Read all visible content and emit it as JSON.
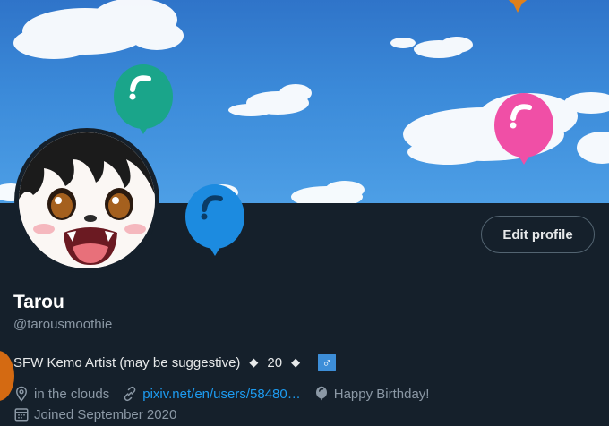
{
  "profile": {
    "display_name": "Tarou",
    "handle": "@tarousmoothie",
    "edit_button_label": "Edit profile",
    "bio": {
      "text": "SFW Kemo Artist (may be suggestive)",
      "sep1": "◆",
      "age": "20",
      "sep2": "◆",
      "gender_symbol": "♂"
    },
    "location": "in the clouds",
    "website": "pixiv.net/en/users/58480…",
    "birthday": "Happy Birthday!",
    "joined": "Joined September 2020"
  },
  "colors": {
    "background": "#15202b",
    "link": "#1d9bf0",
    "muted": "#8b98a5",
    "balloon_teal": "#1aa58a",
    "balloon_pink": "#f04fa6",
    "balloon_blue": "#1c8be0",
    "balloon_orange": "#e0801a"
  },
  "icons": [
    "location-pin-icon",
    "link-icon",
    "balloon-icon",
    "calendar-icon"
  ]
}
